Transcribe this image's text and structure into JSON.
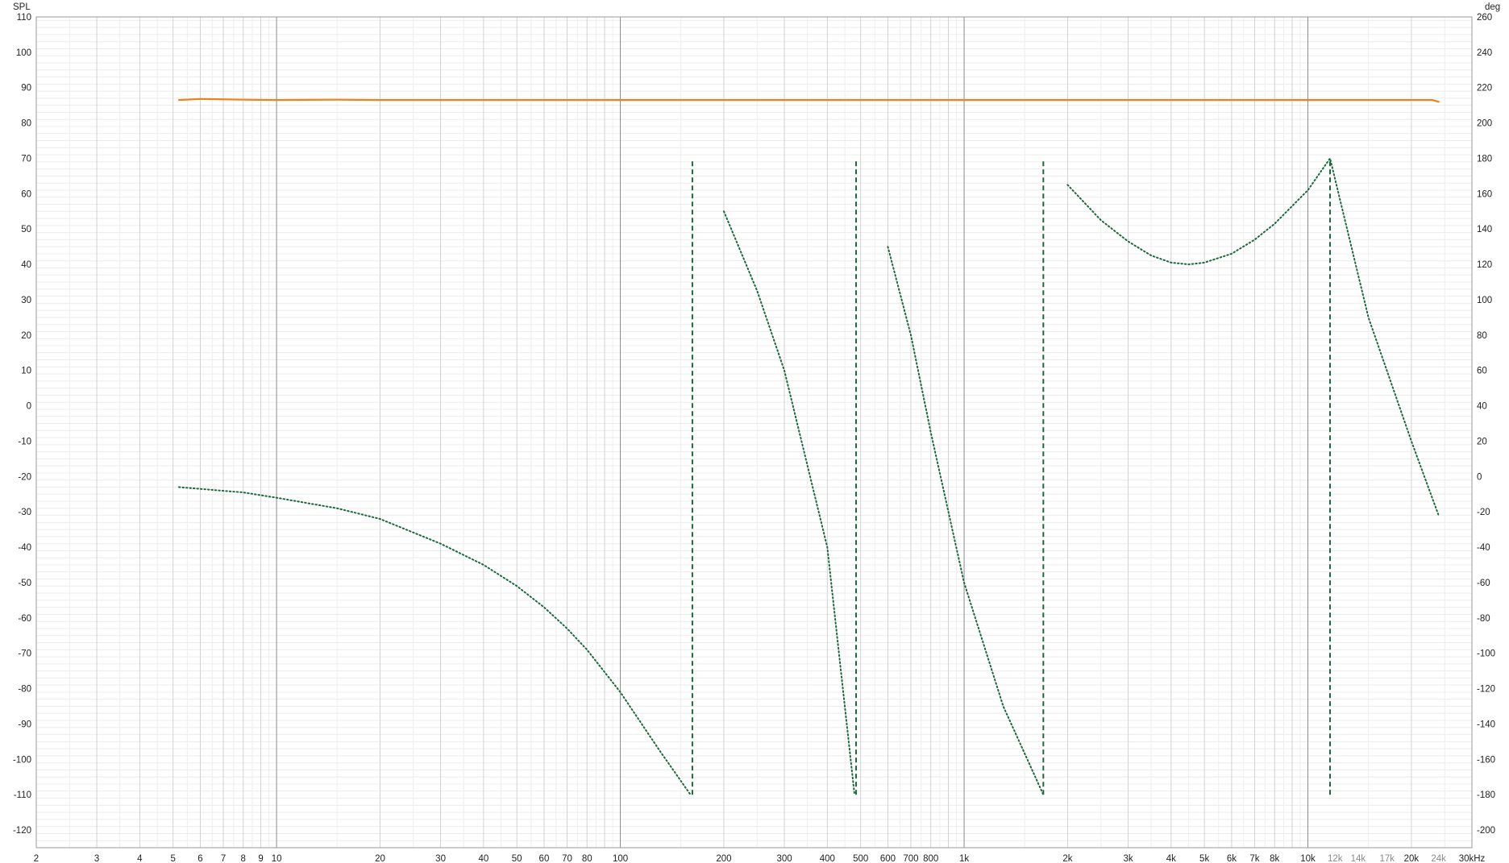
{
  "chart_data": {
    "type": "line",
    "left_axis_label": "SPL",
    "right_axis_label": "deg",
    "x_unit": "kHz",
    "x_scale": "log",
    "xlim": [
      2,
      30000
    ],
    "ylim": [
      -125,
      110
    ],
    "y2lim": [
      -210,
      260
    ],
    "y_ticks": [
      110,
      100,
      90,
      80,
      70,
      60,
      50,
      40,
      30,
      20,
      10,
      0,
      -10,
      -20,
      -30,
      -40,
      -50,
      -60,
      -70,
      -80,
      -90,
      -100,
      -110,
      -120
    ],
    "y2_ticks": [
      260,
      240,
      220,
      200,
      180,
      160,
      140,
      120,
      100,
      80,
      60,
      40,
      20,
      0,
      -20,
      -40,
      -60,
      -80,
      -100,
      -120,
      -140,
      -160,
      -180,
      -200
    ],
    "x_ticks": [
      {
        "value": 2,
        "label": "2"
      },
      {
        "value": 3,
        "label": "3"
      },
      {
        "value": 4,
        "label": "4"
      },
      {
        "value": 5,
        "label": "5"
      },
      {
        "value": 6,
        "label": "6"
      },
      {
        "value": 7,
        "label": "7"
      },
      {
        "value": 8,
        "label": "8"
      },
      {
        "value": 9,
        "label": "9"
      },
      {
        "value": 10,
        "label": "10"
      },
      {
        "value": 20,
        "label": "20"
      },
      {
        "value": 30,
        "label": "30"
      },
      {
        "value": 40,
        "label": "40"
      },
      {
        "value": 50,
        "label": "50"
      },
      {
        "value": 60,
        "label": "60"
      },
      {
        "value": 70,
        "label": "70"
      },
      {
        "value": 80,
        "label": "80"
      },
      {
        "value": 100,
        "label": "100"
      },
      {
        "value": 200,
        "label": "200"
      },
      {
        "value": 300,
        "label": "300"
      },
      {
        "value": 400,
        "label": "400"
      },
      {
        "value": 500,
        "label": "500"
      },
      {
        "value": 600,
        "label": "600"
      },
      {
        "value": 700,
        "label": "700"
      },
      {
        "value": 800,
        "label": "800"
      },
      {
        "value": 1000,
        "label": "1k"
      },
      {
        "value": 2000,
        "label": "2k"
      },
      {
        "value": 3000,
        "label": "3k"
      },
      {
        "value": 4000,
        "label": "4k"
      },
      {
        "value": 5000,
        "label": "5k"
      },
      {
        "value": 6000,
        "label": "6k"
      },
      {
        "value": 7000,
        "label": "7k"
      },
      {
        "value": 8000,
        "label": "8k"
      },
      {
        "value": 10000,
        "label": "10k"
      },
      {
        "value": 12000,
        "label": "12k",
        "muted": true
      },
      {
        "value": 14000,
        "label": "14k",
        "muted": true
      },
      {
        "value": 17000,
        "label": "17k",
        "muted": true
      },
      {
        "value": 20000,
        "label": "20k"
      },
      {
        "value": 24000,
        "label": "24k",
        "muted": true
      },
      {
        "value": 30000,
        "label": "30kHz"
      }
    ],
    "grid": true,
    "series": [
      {
        "axis": "left",
        "color": "#e8841a",
        "style": "solid",
        "x": [
          5.2,
          6,
          8,
          10,
          15,
          20,
          100,
          1000,
          10000,
          20000,
          23000,
          24000
        ],
        "y": [
          86.5,
          86.8,
          86.6,
          86.5,
          86.6,
          86.5,
          86.5,
          86.5,
          86.5,
          86.5,
          86.5,
          86.0
        ]
      },
      {
        "axis": "right",
        "color": "#1a6b3c",
        "style": "dotted",
        "x": [
          5.2,
          6,
          8,
          10,
          15,
          20,
          30,
          40,
          50,
          60,
          70,
          80,
          100,
          130,
          160,
          200,
          250,
          300,
          400,
          480,
          600,
          700,
          800,
          1000,
          1300,
          1700,
          2000,
          2500,
          3000,
          3500,
          4000,
          4500,
          5000,
          6000,
          7000,
          8000,
          10000,
          11600,
          15000,
          20000,
          24000
        ],
        "y": [
          -6,
          -7,
          -9,
          -12,
          -18,
          -24,
          -38,
          -50,
          -62,
          -74,
          -86,
          -98,
          -122,
          -155,
          -180,
          150,
          105,
          60,
          -40,
          -180,
          130,
          80,
          25,
          -60,
          -130,
          -180,
          165,
          145,
          133,
          125,
          121,
          120,
          121,
          126,
          134,
          143,
          162,
          180,
          90,
          20,
          -22
        ]
      },
      {
        "axis": "right",
        "color": "#1a6b3c",
        "style": "dashed",
        "segments": [
          {
            "x": 162,
            "y": [
              -180,
              180
            ]
          },
          {
            "x": 485,
            "y": [
              -180,
              180
            ]
          },
          {
            "x": 1700,
            "y": [
              -180,
              180
            ]
          },
          {
            "x": 11600,
            "y": [
              -180,
              180
            ]
          }
        ]
      }
    ]
  }
}
